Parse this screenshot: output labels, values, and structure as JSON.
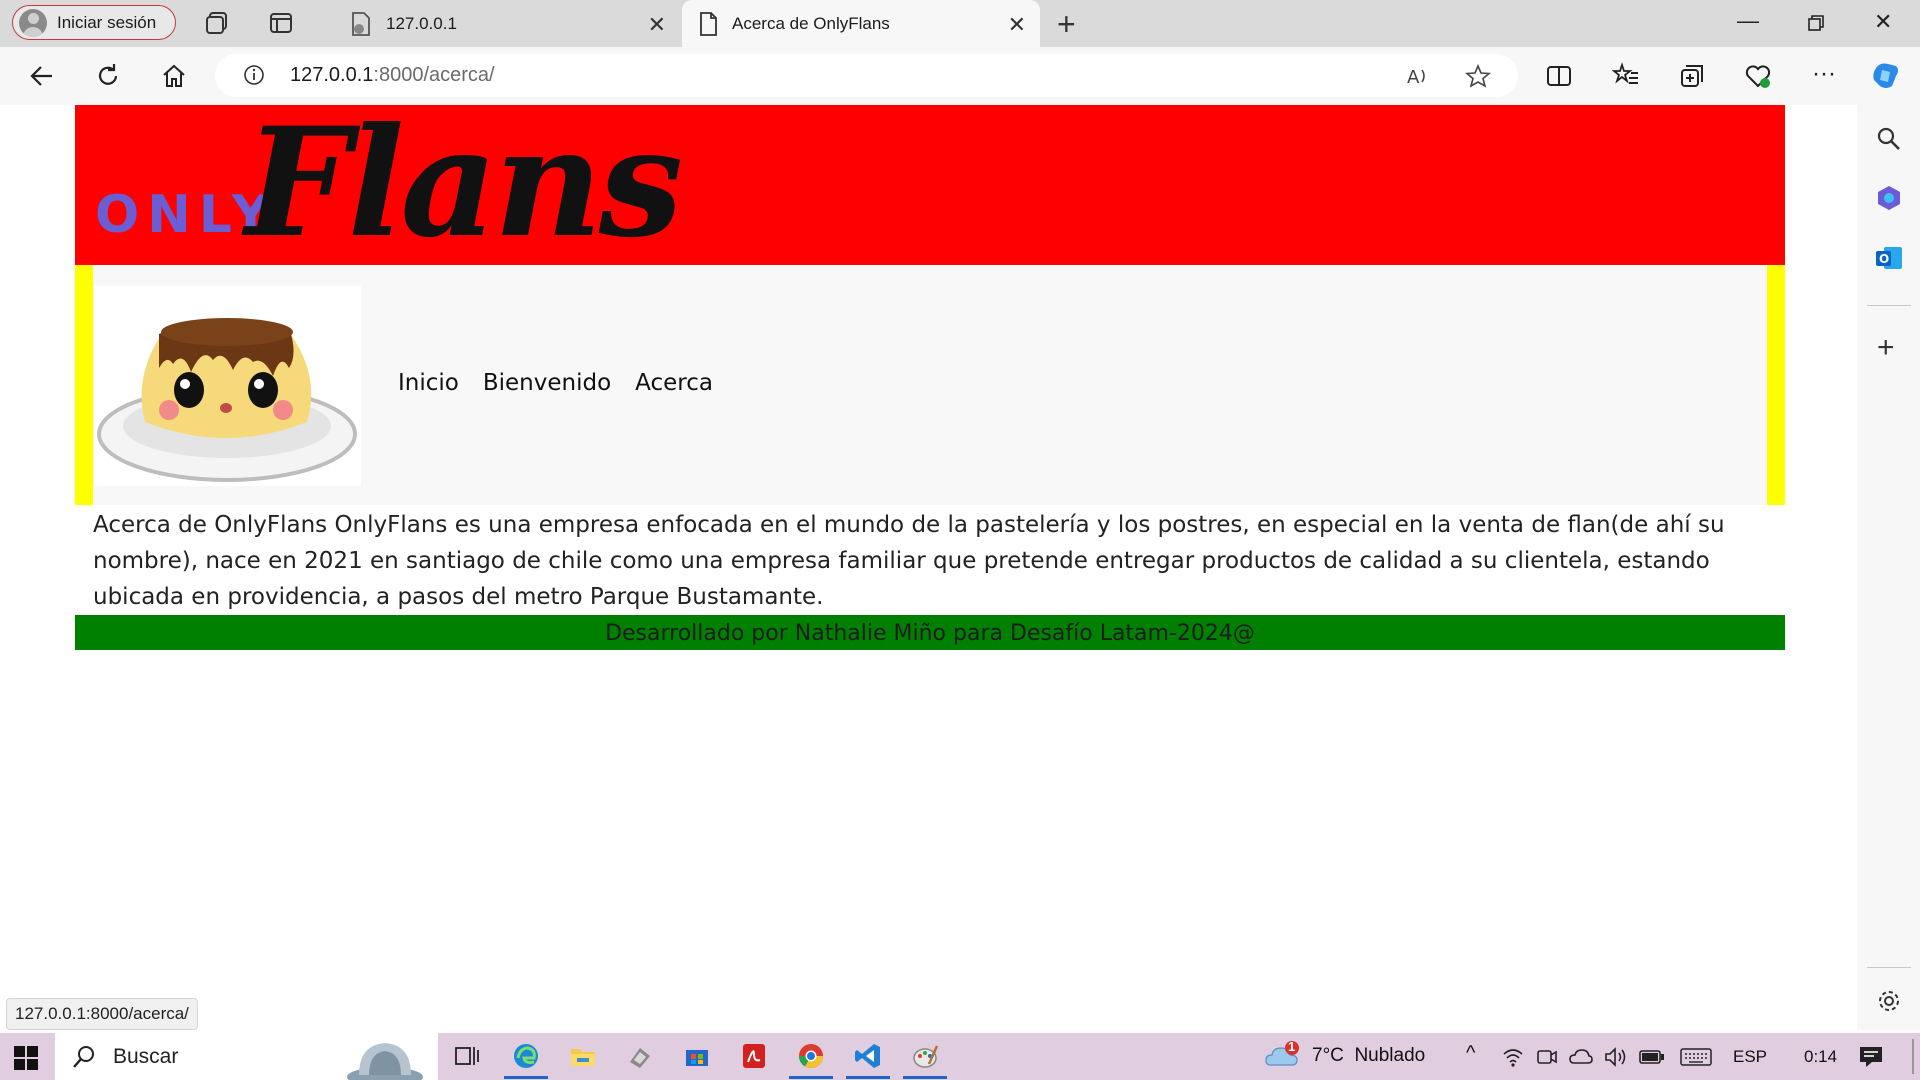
{
  "browser": {
    "profile_label": "Iniciar sesión",
    "tabs": [
      {
        "title": "127.0.0.1",
        "active": false
      },
      {
        "title": "Acerca de OnlyFlans",
        "active": true
      }
    ],
    "address": {
      "host": "127.0.0.1",
      "path": ":8000/acerca/"
    },
    "status_url": "127.0.0.1:8000/acerca/"
  },
  "site": {
    "logo": {
      "small": "ONLY",
      "script": "Flans"
    },
    "nav": [
      "Inicio",
      "Bienvenido",
      "Acerca"
    ],
    "about_text": "Acerca de OnlyFlans OnlyFlans es una empresa enfocada en el mundo de la pastelería y los postres, en especial en la venta de flan(de ahí su nombre), nace en 2021 en santiago de chile como una empresa familiar que pretende entregar productos de calidad a su clientela, estando ubicada en providencia, a pasos del metro Parque Bustamante.",
    "footer": "Desarrollado por Nathalie Miño para Desafío Latam-2024@",
    "colors": {
      "header": "#ff0000",
      "border": "#ffff00",
      "footer": "#008000",
      "logo_only": "#6b5dd3"
    }
  },
  "taskbar": {
    "search_label": "Buscar",
    "weather_badge": "1",
    "weather": "7°C  Nublado",
    "language": "ESP",
    "time": "0:14"
  }
}
